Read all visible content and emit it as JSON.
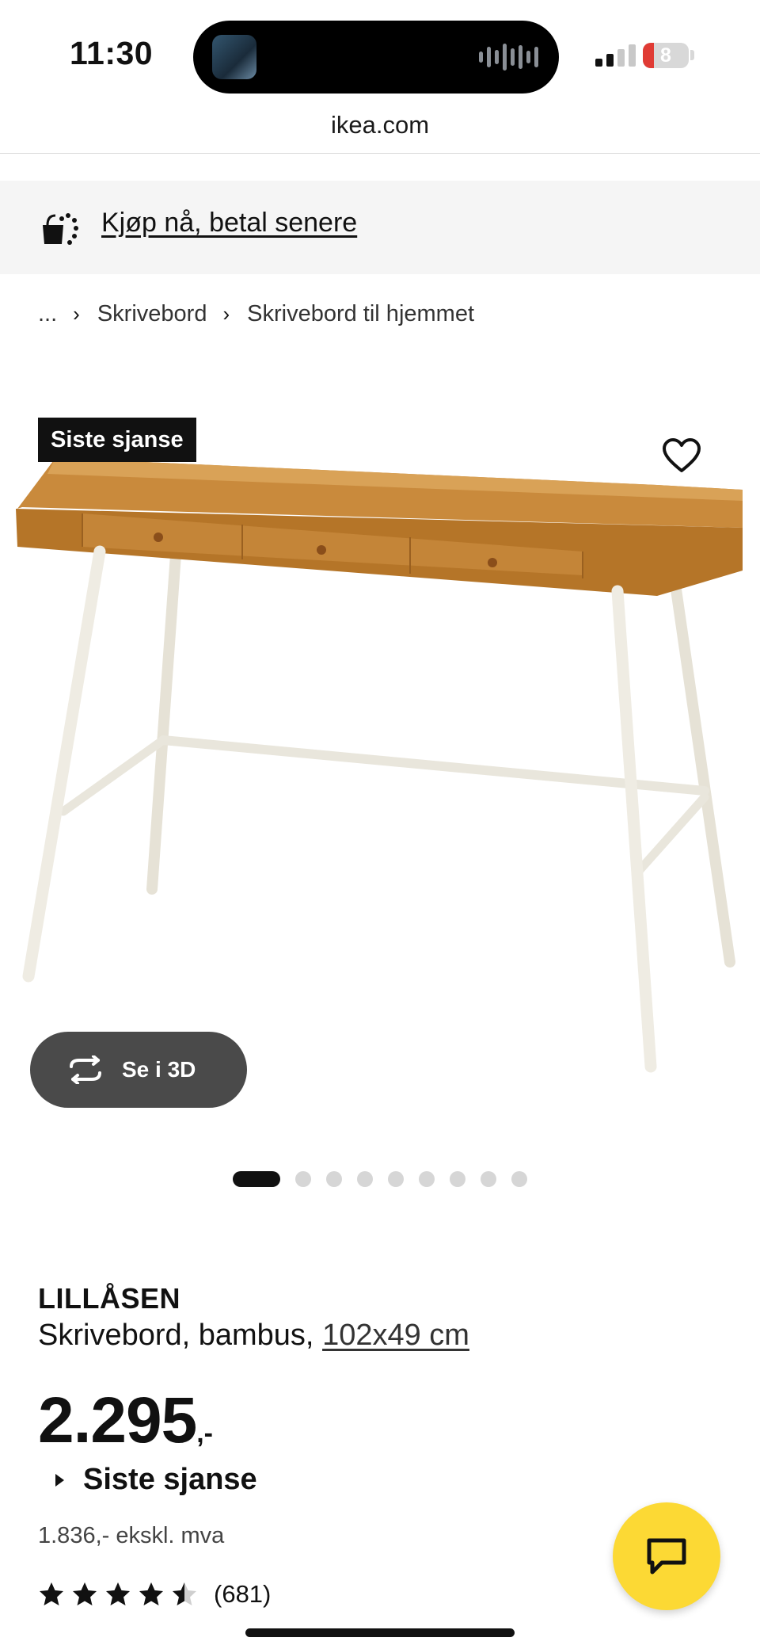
{
  "status_bar": {
    "time": "11:30",
    "battery": "8"
  },
  "browser": {
    "url": "ikea.com"
  },
  "promo": {
    "text": "Kjøp nå, betal senere"
  },
  "breadcrumb": {
    "ellipsis": "...",
    "items": [
      "Skrivebord",
      "Skrivebord til hjemmet"
    ]
  },
  "product": {
    "badge": "Siste sjanse",
    "view_3d": "Se i 3D",
    "gallery": {
      "current": 1,
      "total": 9
    },
    "name": "LILLÅSEN",
    "description": "Skrivebord, bambus,",
    "size": "102x49 cm",
    "price_integer": "2.295",
    "price_suffix": ",-",
    "availability": "Siste sjanse",
    "price_ex_vat": "1.836,- ekskl. mva",
    "rating": 4.5,
    "review_count": "(681)"
  },
  "icons": {
    "favorite": "heart-outline-icon",
    "view3d": "rotate-icon",
    "chat": "chat-bubble-icon",
    "promo": "bag-installment-icon",
    "breadcrumb_separator": "chevron-right-icon",
    "rating_star": "star-icon"
  },
  "colors": {
    "accent": "#fcd934",
    "badge_bg": "#111111",
    "desk_wood": "#c98a3c",
    "desk_legs": "#e9e6dc"
  }
}
